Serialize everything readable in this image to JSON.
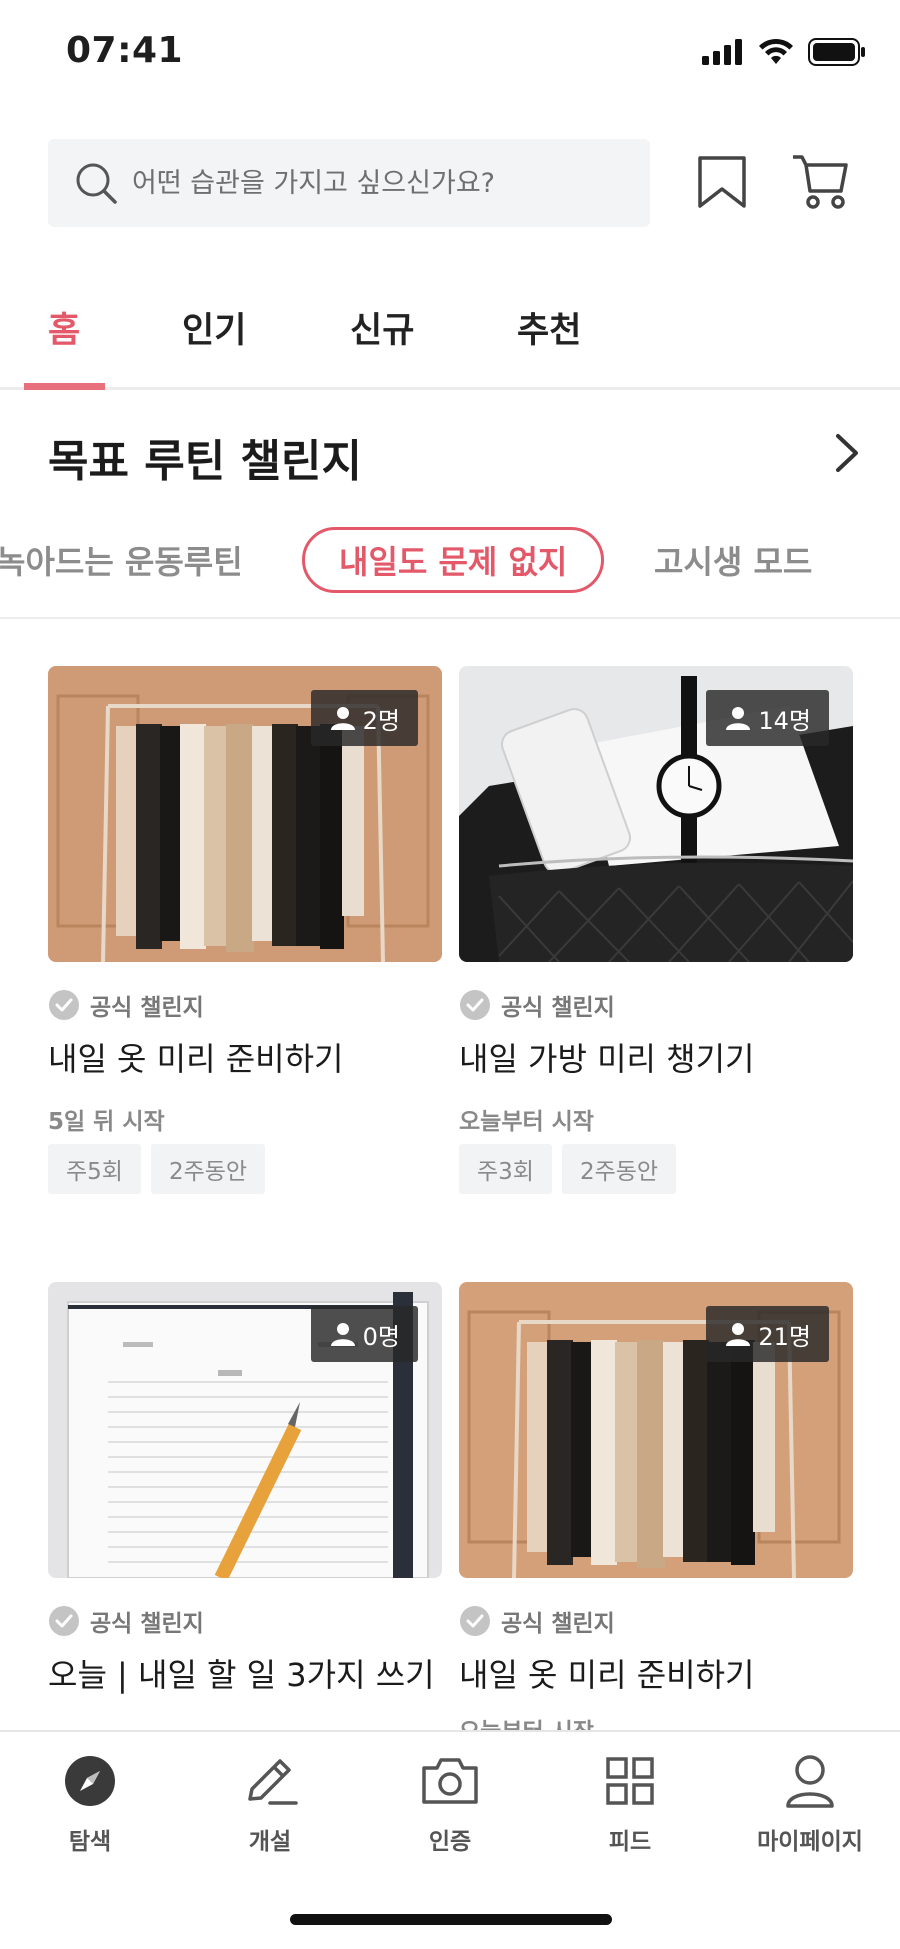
{
  "status_bar": {
    "time": "07:41",
    "signal_icon": "cellular-signal-icon",
    "wifi_icon": "wifi-icon",
    "battery_icon": "battery-icon"
  },
  "search": {
    "placeholder": "어떤 습관을 가지고 싶으신가요?",
    "icon": "search-icon"
  },
  "header_icons": {
    "bookmark": "bookmark-icon",
    "cart": "cart-icon"
  },
  "tabs": [
    {
      "label": "홈",
      "active": true
    },
    {
      "label": "인기",
      "active": false
    },
    {
      "label": "신규",
      "active": false
    },
    {
      "label": "추천",
      "active": false
    }
  ],
  "section": {
    "title": "목표 루틴 챌린지",
    "more_icon": "chevron-right-icon"
  },
  "chips": [
    {
      "label": "녹아드는 운동루틴",
      "active": false
    },
    {
      "label": "내일도 문제 없지",
      "active": true
    },
    {
      "label": "고시생 모드",
      "active": false
    }
  ],
  "cards": [
    {
      "count": "2명",
      "official": "공식 챌린지",
      "title": "내일 옷 미리 준비하기",
      "start": "5일 뒤 시작",
      "tags": [
        "주5회",
        "2주동안"
      ],
      "image": "clothes-rack-photo"
    },
    {
      "count": "14명",
      "official": "공식 챌린지",
      "title": "내일 가방 미리 챙기기",
      "start": "오늘부터 시작",
      "tags": [
        "주3회",
        "2주동안"
      ],
      "image": "bag-phone-watch-photo"
    },
    {
      "count": "0명",
      "official": "공식 챌린지",
      "title": "오늘 | 내일 할 일 3가지 쓰기",
      "start": "",
      "tags": [],
      "image": "planner-pencil-photo"
    },
    {
      "count": "21명",
      "official": "공식 챌린지",
      "title": "내일 옷 미리 준비하기",
      "start": "오늘부터 시작",
      "tags": [],
      "image": "clothes-rack-photo"
    }
  ],
  "bottom_nav": [
    {
      "label": "탐색",
      "icon": "compass-icon",
      "active": true
    },
    {
      "label": "개설",
      "icon": "pencil-icon",
      "active": false
    },
    {
      "label": "인증",
      "icon": "camera-icon",
      "active": false
    },
    {
      "label": "피드",
      "icon": "grid-icon",
      "active": false
    },
    {
      "label": "마이페이지",
      "icon": "profile-icon",
      "active": false
    }
  ],
  "colors": {
    "accent": "#e3596a",
    "search_bg": "#f3f4f6",
    "tag_bg": "#f2f3f5"
  }
}
